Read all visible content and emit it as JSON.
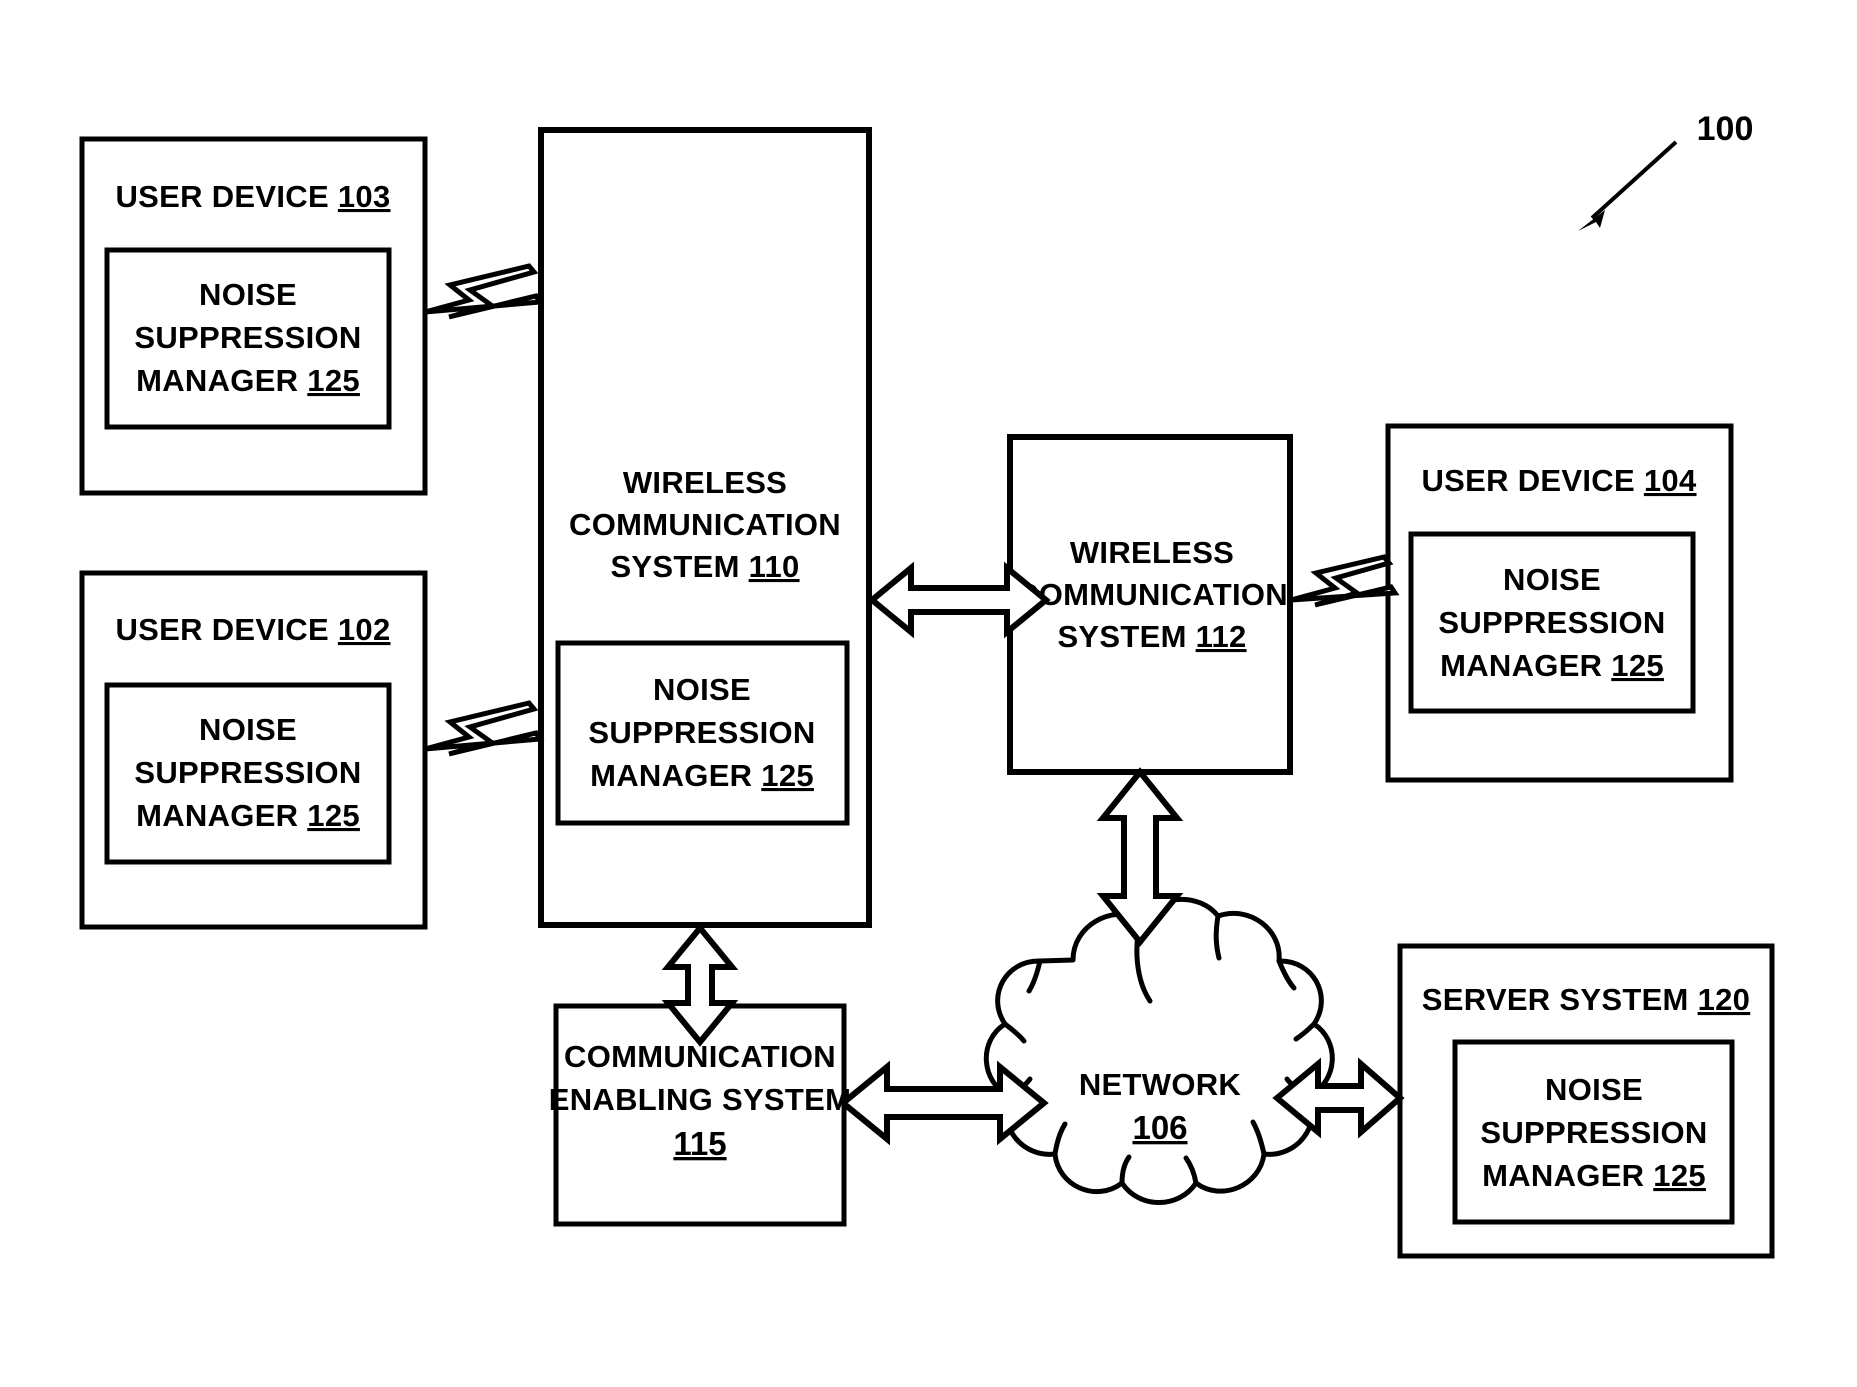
{
  "figure": {
    "number": "100",
    "number_underlined": false
  },
  "nodes": {
    "user_device_103": {
      "title_text": "USER DEVICE",
      "title_ref": "103",
      "inner": {
        "line1": "NOISE",
        "line2": "SUPPRESSION",
        "line3_text": "MANAGER",
        "line3_ref": "125"
      }
    },
    "user_device_102": {
      "title_text": "USER DEVICE",
      "title_ref": "102",
      "inner": {
        "line1": "NOISE",
        "line2": "SUPPRESSION",
        "line3_text": "MANAGER",
        "line3_ref": "125"
      }
    },
    "user_device_104": {
      "title_text": "USER DEVICE",
      "title_ref": "104",
      "inner": {
        "line1": "NOISE",
        "line2": "SUPPRESSION",
        "line3_text": "MANAGER",
        "line3_ref": "125"
      }
    },
    "wireless_communication_system_110": {
      "line1": "WIRELESS",
      "line2": "COMMUNICATION",
      "line3_text": "SYSTEM",
      "line3_ref": "110",
      "inner": {
        "line1": "NOISE",
        "line2": "SUPPRESSION",
        "line3_text": "MANAGER",
        "line3_ref": "125"
      }
    },
    "wireless_communication_system_112": {
      "line1": "WIRELESS",
      "line2": "COMMUNICATION",
      "line3_text": "SYSTEM",
      "line3_ref": "112"
    },
    "communication_enabling_system_115": {
      "line1": "COMMUNICATION",
      "line2": "ENABLING SYSTEM",
      "line3_ref": "115"
    },
    "network_106": {
      "line1": "NETWORK",
      "line2_ref": "106"
    },
    "server_system_120": {
      "title_text": "SERVER SYSTEM",
      "title_ref": "120",
      "inner": {
        "line1": "NOISE",
        "line2": "SUPPRESSION",
        "line3_text": "MANAGER",
        "line3_ref": "125"
      }
    }
  },
  "connectors": {
    "bolt_103_to_110": "wireless-link",
    "bolt_102_to_110": "wireless-link",
    "bolt_112_to_104": "wireless-link",
    "arrow_110_to_112": "bidirectional",
    "arrow_110_to_115": "bidirectional",
    "arrow_112_to_106": "bidirectional",
    "arrow_115_to_106": "bidirectional",
    "arrow_106_to_120": "bidirectional"
  },
  "colors": {
    "stroke": "#000000",
    "fill": "#ffffff",
    "background": "#ffffff"
  }
}
